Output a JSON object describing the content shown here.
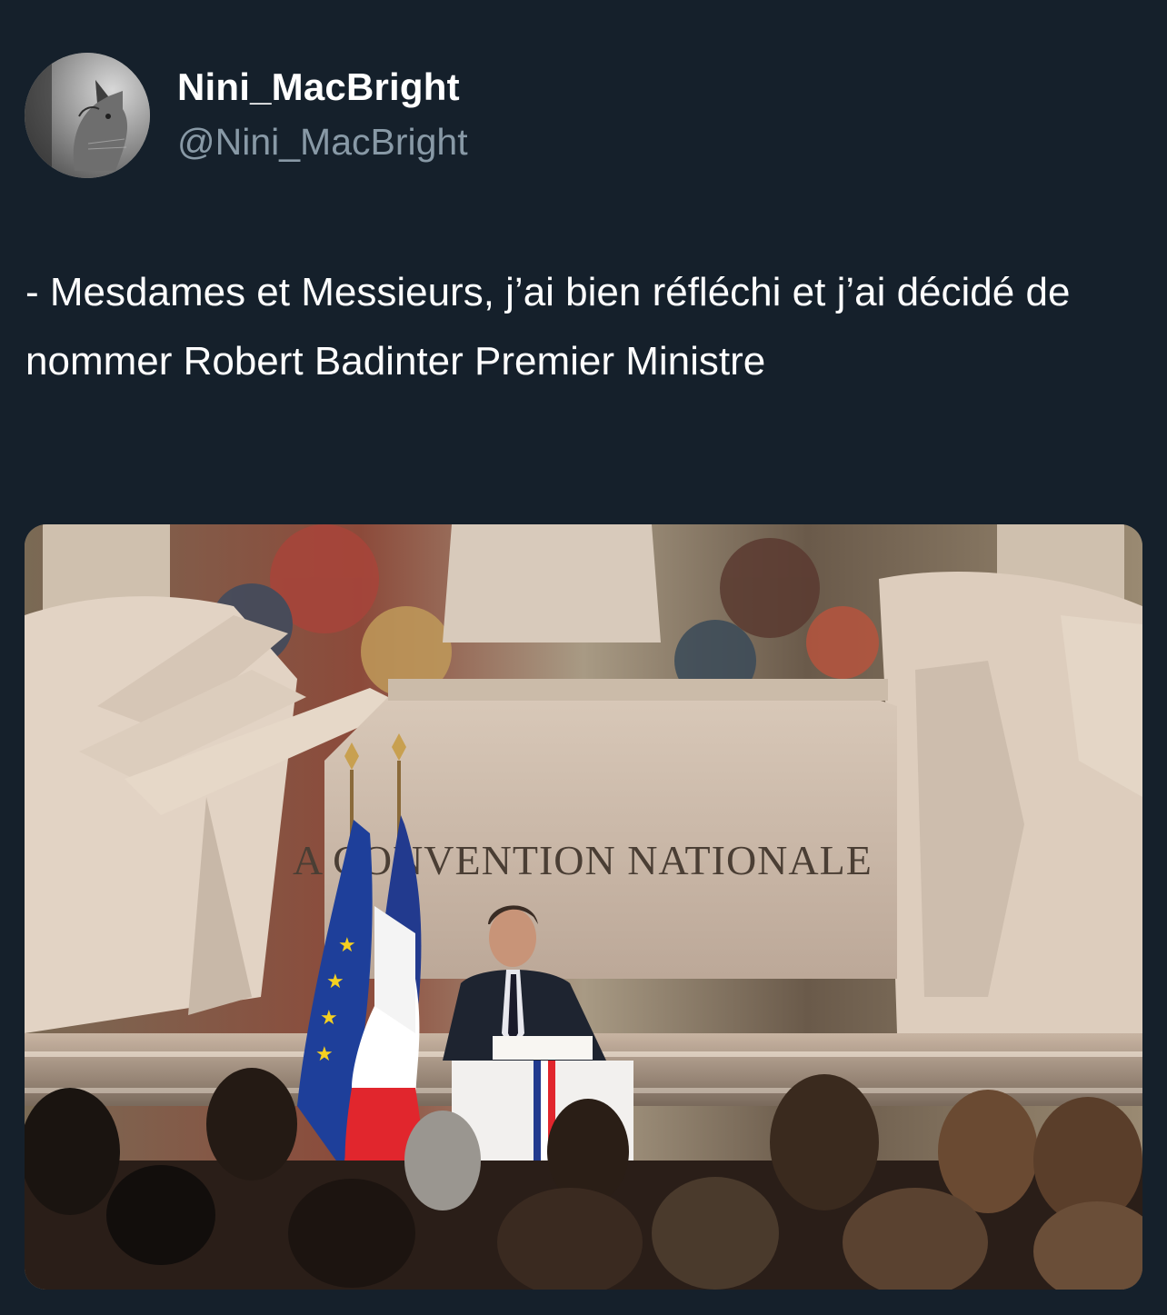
{
  "author": {
    "display_name": "Nini_MacBright",
    "handle": "@Nini_MacBright",
    "avatar_icon": "cat-avatar-icon"
  },
  "tweet": {
    "text": "- Mesdames et Messieurs, j’ai bien réfléchi et j’ai décidé de nommer Robert Badinter Premier Ministre"
  },
  "media": {
    "monument_inscription": "A CONVENTION NATIONALE",
    "background_color": "#15202b"
  }
}
